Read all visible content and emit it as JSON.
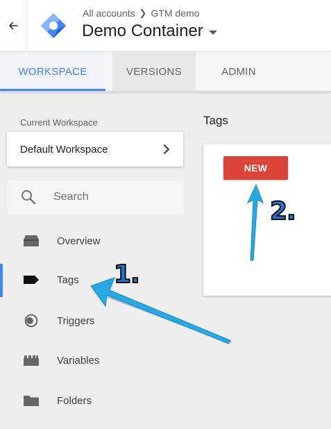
{
  "header": {
    "breadcrumb": {
      "accounts": "All accounts",
      "account": "GTM demo"
    },
    "container_name": "Demo Container"
  },
  "tabs": [
    {
      "label": "WORKSPACE",
      "active": true
    },
    {
      "label": "VERSIONS",
      "active": false
    },
    {
      "label": "ADMIN",
      "active": false
    }
  ],
  "sidebar": {
    "current_workspace_label": "Current Workspace",
    "workspace_name": "Default Workspace",
    "search": {
      "placeholder": "Search",
      "value": ""
    },
    "items": [
      {
        "label": "Overview",
        "icon": "overview-icon",
        "active": false
      },
      {
        "label": "Tags",
        "icon": "tag-icon",
        "active": true
      },
      {
        "label": "Triggers",
        "icon": "trigger-icon",
        "active": false
      },
      {
        "label": "Variables",
        "icon": "variables-icon",
        "active": false
      },
      {
        "label": "Folders",
        "icon": "folder-icon",
        "active": false
      }
    ]
  },
  "main": {
    "heading": "Tags",
    "new_button_label": "NEW"
  },
  "annotations": {
    "step1": "1.",
    "step2": "2."
  },
  "colors": {
    "accent": "#4285f4",
    "new_button": "#db4437",
    "annotation_arrow": "#29a8e6",
    "annotation_number": "#1d79d6"
  }
}
